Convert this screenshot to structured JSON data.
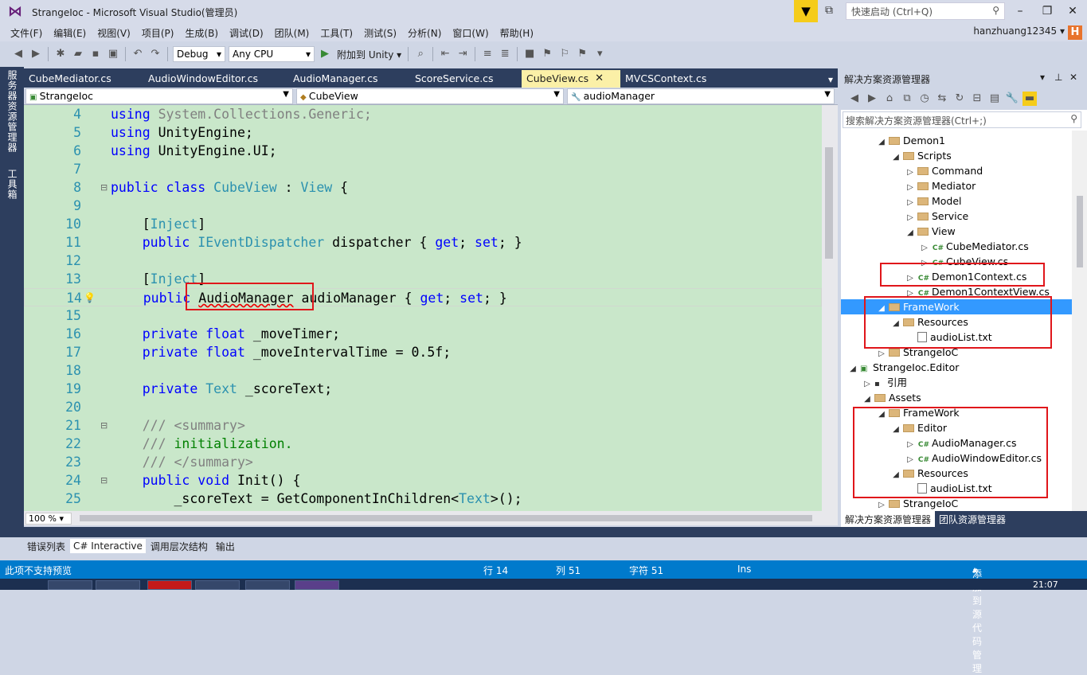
{
  "window": {
    "title": "StrangeIoc - Microsoft Visual Studio(管理员)",
    "quicklaunch_placeholder": "快速启动 (Ctrl+Q)",
    "user": "hanzhuang12345",
    "user_badge": "H"
  },
  "menu": [
    "文件(F)",
    "编辑(E)",
    "视图(V)",
    "项目(P)",
    "生成(B)",
    "调试(D)",
    "团队(M)",
    "工具(T)",
    "测试(S)",
    "分析(N)",
    "窗口(W)",
    "帮助(H)"
  ],
  "toolbar": {
    "config": "Debug",
    "platform": "Any CPU",
    "attach": "附加到 Unity"
  },
  "left_tabs": [
    "服务器资源管理器",
    "工具箱"
  ],
  "doc_tabs": [
    "CubeMediator.cs",
    "AudioWindowEditor.cs",
    "AudioManager.cs",
    "ScoreService.cs",
    "CubeView.cs",
    "MVCSContext.cs"
  ],
  "active_tab": "CubeView.cs",
  "nav": {
    "project": "StrangeIoc",
    "type": "CubeView",
    "member": "audioManager"
  },
  "code_lines": [
    {
      "n": "4",
      "t": "using System.Collections.Generic;"
    },
    {
      "n": "5",
      "t": "using UnityEngine;"
    },
    {
      "n": "6",
      "t": "using UnityEngine.UI;"
    },
    {
      "n": "7",
      "t": ""
    },
    {
      "n": "8",
      "t": "public class CubeView : View {"
    },
    {
      "n": "9",
      "t": ""
    },
    {
      "n": "10",
      "t": "    [Inject]"
    },
    {
      "n": "11",
      "t": "    public IEventDispatcher dispatcher { get; set; }"
    },
    {
      "n": "12",
      "t": ""
    },
    {
      "n": "13",
      "t": "    [Inject]"
    },
    {
      "n": "14",
      "t": "    public AudioManager audioManager { get; set; }"
    },
    {
      "n": "15",
      "t": ""
    },
    {
      "n": "16",
      "t": "    private float _moveTimer;"
    },
    {
      "n": "17",
      "t": "    private float _moveIntervalTime = 0.5f;"
    },
    {
      "n": "18",
      "t": ""
    },
    {
      "n": "19",
      "t": "    private Text _scoreText;"
    },
    {
      "n": "20",
      "t": ""
    },
    {
      "n": "21",
      "t": "    /// <summary>"
    },
    {
      "n": "22",
      "t": "    /// initialization."
    },
    {
      "n": "23",
      "t": "    /// </summary>"
    },
    {
      "n": "24",
      "t": "    public void Init() {"
    },
    {
      "n": "25",
      "t": "        _scoreText = GetComponentInChildren<Text>();"
    }
  ],
  "zoom": "100 %",
  "solution_explorer": {
    "title": "解决方案资源管理器",
    "search_placeholder": "搜索解决方案资源管理器(Ctrl+;)",
    "nodes": [
      "Demon1",
      "Scripts",
      "Command",
      "Mediator",
      "Model",
      "Service",
      "View",
      "CubeMediator.cs",
      "CubeView.cs",
      "Demon1Context.cs",
      "Demon1ContextView.cs",
      "FrameWork",
      "Resources",
      "audioList.txt",
      "StrangeIoC",
      "StrangeIoc.Editor",
      "引用",
      "Assets",
      "FrameWork",
      "Editor",
      "AudioManager.cs",
      "AudioWindowEditor.cs",
      "Resources",
      "audioList.txt",
      "StrangeIoC"
    ],
    "bottom_tabs": [
      "解决方案资源管理器",
      "团队资源管理器"
    ]
  },
  "output_tabs": [
    "错误列表",
    "C# Interactive",
    "调用层次结构",
    "输出"
  ],
  "status": {
    "message": "此项不支持预览",
    "line": "行 14",
    "col": "列 51",
    "char": "字符 51",
    "mode": "Ins",
    "source_control": "添加到源代码管理"
  },
  "clock": "21:07",
  "colors": {
    "editor_bg": "#c9e7ca",
    "selection": "#3399ff",
    "statusbar": "#007acc",
    "highlight_box": "#e0161b"
  }
}
